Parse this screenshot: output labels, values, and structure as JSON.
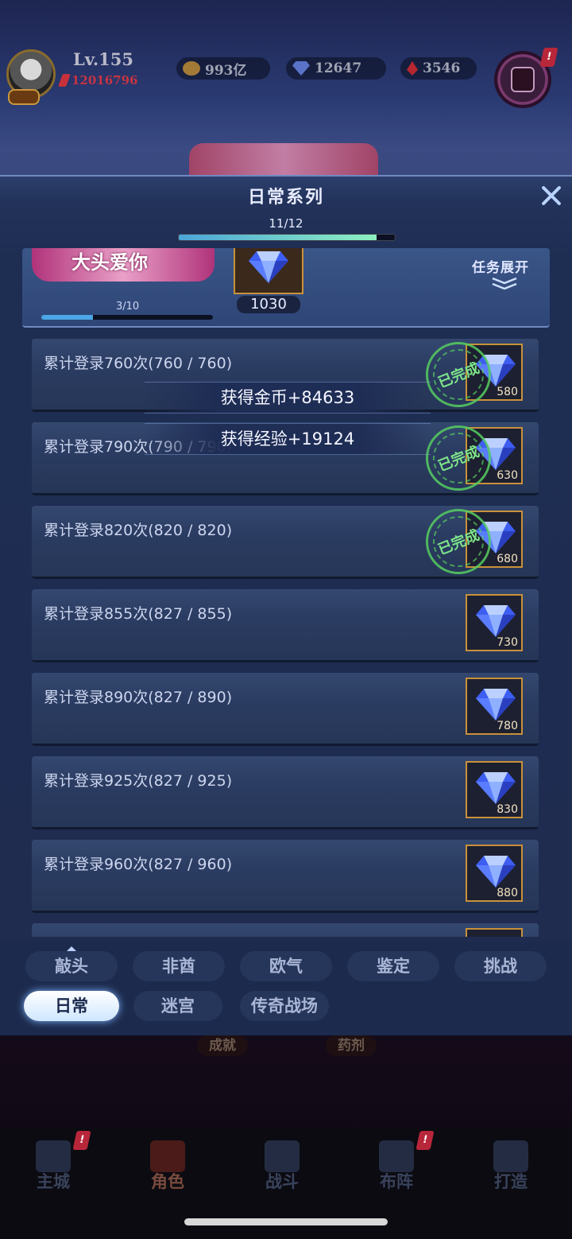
{
  "hud": {
    "level": "Lv.155",
    "power": "12016796",
    "gold": "993亿",
    "crystal": "12647",
    "ruby": "3546",
    "corner_alert": "!"
  },
  "modal": {
    "title": "日常系列",
    "progress_text": "11/12",
    "progress_fraction": 0.917
  },
  "series": {
    "banner_text": "大头爱你",
    "reward_count": "1030",
    "progress_text": "3/10",
    "progress_fraction": 0.3,
    "expand_label": "任务展开"
  },
  "tasks": [
    {
      "label": "累计登录760次(760 / 760)",
      "reward": "580",
      "completed": true
    },
    {
      "label": "累计登录790次(790 / 790)",
      "reward": "630",
      "completed": true
    },
    {
      "label": "累计登录820次(820 / 820)",
      "reward": "680",
      "completed": true
    },
    {
      "label": "累计登录855次(827 / 855)",
      "reward": "730",
      "completed": false
    },
    {
      "label": "累计登录890次(827 / 890)",
      "reward": "780",
      "completed": false
    },
    {
      "label": "累计登录925次(827 / 925)",
      "reward": "830",
      "completed": false
    },
    {
      "label": "累计登录960次(827 / 960)",
      "reward": "880",
      "completed": false
    }
  ],
  "stamp_text": "已完成",
  "popups": [
    "获得金币+84633",
    "获得经验+19124"
  ],
  "tabs_row1": [
    "敲头",
    "非酋",
    "欧气",
    "鉴定",
    "挑战"
  ],
  "tabs_row2": [
    "日常",
    "迷宫",
    "传奇战场"
  ],
  "active_tab": "日常",
  "bottom_labels": [
    "成就",
    "药剂"
  ],
  "nav": [
    {
      "label": "主城",
      "active": false,
      "alert": true
    },
    {
      "label": "角色",
      "active": true,
      "alert": false
    },
    {
      "label": "战斗",
      "active": false,
      "alert": false
    },
    {
      "label": "布阵",
      "active": false,
      "alert": true
    },
    {
      "label": "打造",
      "active": false,
      "alert": false
    }
  ],
  "alert_mark": "!",
  "colors": {
    "accent": "#8df0c0",
    "gold_border": "#c9913a",
    "stamp_green": "#56ce60",
    "power_red": "#c73442"
  }
}
